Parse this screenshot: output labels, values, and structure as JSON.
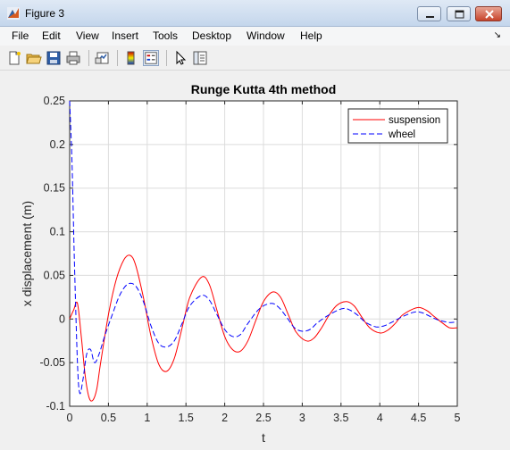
{
  "window": {
    "title": "Figure 3"
  },
  "menu": [
    "File",
    "Edit",
    "View",
    "Insert",
    "Tools",
    "Desktop",
    "Window",
    "Help"
  ],
  "menu_arrow": "↘",
  "toolbar": {
    "icons": [
      "new-figure-icon",
      "open-file-icon",
      "save-icon",
      "print-icon",
      "link-plot-icon",
      "colorbar-icon",
      "legend-icon",
      "pointer-icon",
      "property-inspector-icon"
    ]
  },
  "chart_data": {
    "type": "line",
    "title": "Runge Kutta 4th method",
    "xlabel": "t",
    "ylabel": "x displacement (m)",
    "xlim": [
      0,
      5
    ],
    "ylim": [
      -0.1,
      0.25
    ],
    "xticks": [
      "0",
      "0.5",
      "1",
      "1.5",
      "2",
      "2.5",
      "3",
      "3.5",
      "4",
      "4.5",
      "5"
    ],
    "yticks": [
      "-0.1",
      "-0.05",
      "0",
      "0.05",
      "0.1",
      "0.15",
      "0.2",
      "0.25"
    ],
    "grid": true,
    "legend_position": "top-right",
    "series": [
      {
        "name": "suspension",
        "color": "#ff0000",
        "style": "solid",
        "x": [
          0,
          0.05,
          0.1,
          0.15,
          0.2,
          0.25,
          0.3,
          0.35,
          0.4,
          0.5,
          0.6,
          0.7,
          0.78,
          0.85,
          0.95,
          1.05,
          1.15,
          1.25,
          1.35,
          1.45,
          1.55,
          1.7,
          1.8,
          1.9,
          2.0,
          2.1,
          2.2,
          2.3,
          2.4,
          2.5,
          2.62,
          2.72,
          2.82,
          2.92,
          3.05,
          3.15,
          3.25,
          3.35,
          3.45,
          3.57,
          3.67,
          3.77,
          3.87,
          4.0,
          4.1,
          4.2,
          4.3,
          4.48,
          4.6,
          4.7,
          4.8,
          4.9,
          5.0
        ],
        "y": [
          0,
          0.01,
          0.018,
          -0.02,
          -0.065,
          -0.09,
          -0.093,
          -0.08,
          -0.05,
          0.005,
          0.045,
          0.068,
          0.073,
          0.062,
          0.025,
          -0.02,
          -0.052,
          -0.06,
          -0.045,
          -0.01,
          0.025,
          0.048,
          0.04,
          0.01,
          -0.02,
          -0.035,
          -0.037,
          -0.025,
          -0.002,
          0.02,
          0.031,
          0.025,
          0.005,
          -0.015,
          -0.025,
          -0.022,
          -0.01,
          0.005,
          0.016,
          0.02,
          0.015,
          0.002,
          -0.01,
          -0.016,
          -0.013,
          -0.005,
          0.005,
          0.013,
          0.01,
          0.003,
          -0.004,
          -0.01,
          -0.01
        ]
      },
      {
        "name": "wheel",
        "color": "#0000ff",
        "style": "dashed",
        "x": [
          0,
          0.03,
          0.06,
          0.1,
          0.13,
          0.17,
          0.22,
          0.27,
          0.32,
          0.38,
          0.45,
          0.55,
          0.65,
          0.75,
          0.85,
          0.95,
          1.05,
          1.15,
          1.25,
          1.35,
          1.45,
          1.55,
          1.7,
          1.8,
          1.9,
          2.0,
          2.1,
          2.2,
          2.3,
          2.45,
          2.6,
          2.7,
          2.8,
          2.9,
          3.0,
          3.1,
          3.2,
          3.35,
          3.52,
          3.62,
          3.72,
          3.82,
          3.95,
          4.05,
          4.15,
          4.3,
          4.45,
          4.55,
          4.65,
          4.75,
          4.9,
          5.0
        ],
        "y": [
          0.25,
          0.18,
          0.07,
          -0.05,
          -0.085,
          -0.07,
          -0.04,
          -0.035,
          -0.05,
          -0.04,
          -0.02,
          0.005,
          0.028,
          0.04,
          0.038,
          0.02,
          -0.008,
          -0.028,
          -0.032,
          -0.025,
          -0.005,
          0.015,
          0.027,
          0.022,
          0.005,
          -0.012,
          -0.02,
          -0.018,
          -0.005,
          0.012,
          0.018,
          0.013,
          0.002,
          -0.01,
          -0.014,
          -0.012,
          -0.004,
          0.005,
          0.012,
          0.01,
          0.004,
          -0.004,
          -0.009,
          -0.008,
          -0.004,
          0.003,
          0.008,
          0.007,
          0.003,
          -0.001,
          -0.004,
          -0.003
        ]
      }
    ]
  }
}
